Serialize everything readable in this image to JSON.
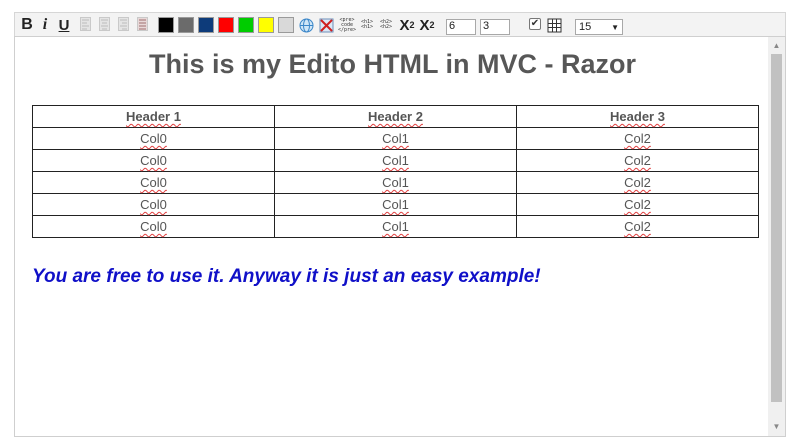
{
  "toolbar": {
    "bold_label": "B",
    "italic_label": "i",
    "underline_label": "U",
    "align_icons": [
      "align-left-icon",
      "align-center-icon",
      "align-right-icon",
      "align-justify-icon"
    ],
    "color_swatches": [
      "#000000",
      "#6b6b6b",
      "#0d3b7a",
      "#ff0000",
      "#00cc00",
      "#ffff00",
      "#d9d9d9"
    ],
    "code_snippets": [
      "<pre> code </pre>",
      "<h1> <h1>",
      "<h2> <h2>"
    ],
    "subscript_label": "X",
    "subscript_mark": "2",
    "superscript_label": "X",
    "superscript_mark": "2",
    "table_rows_value": "6",
    "table_cols_value": "3",
    "header_checkbox_checked": true,
    "font_size_value": "15"
  },
  "document": {
    "title": "This is my Edito HTML in MVC - Razor",
    "table": {
      "headers": [
        "Header 1",
        "Header 2",
        "Header 3"
      ],
      "rows": [
        [
          "Col0",
          "Col1",
          "Col2"
        ],
        [
          "Col0",
          "Col1",
          "Col2"
        ],
        [
          "Col0",
          "Col1",
          "Col2"
        ],
        [
          "Col0",
          "Col1",
          "Col2"
        ],
        [
          "Col0",
          "Col1",
          "Col2"
        ]
      ]
    },
    "note": "You are free to use it. Anyway it is just an easy example!",
    "note_color": "#1010c8"
  }
}
